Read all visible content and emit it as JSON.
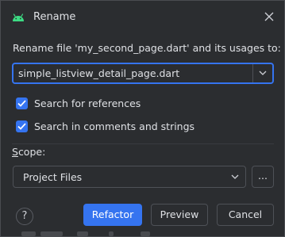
{
  "dialog": {
    "title": "Rename",
    "icon": "android-icon",
    "close_icon": "close-icon"
  },
  "prompt": "Rename file 'my_second_page.dart' and its usages to:",
  "name_field": {
    "value": "simple_listview_detail_page.dart",
    "dropdown_icon": "chevron-down-icon"
  },
  "options": [
    {
      "label": "Search for references",
      "checked": true
    },
    {
      "label": "Search in comments and strings",
      "checked": true
    }
  ],
  "scope": {
    "label_mnemonic": "S",
    "label_rest": "cope:",
    "value": "Project Files",
    "more_label": "..."
  },
  "buttons": {
    "help": "?",
    "refactor": "Refactor",
    "preview": "Preview",
    "cancel": "Cancel"
  },
  "colors": {
    "background": "#2b2d30",
    "accent": "#3574f0",
    "border": "#4e5157",
    "text": "#dfe1e5",
    "android_green": "#3ddc84"
  }
}
